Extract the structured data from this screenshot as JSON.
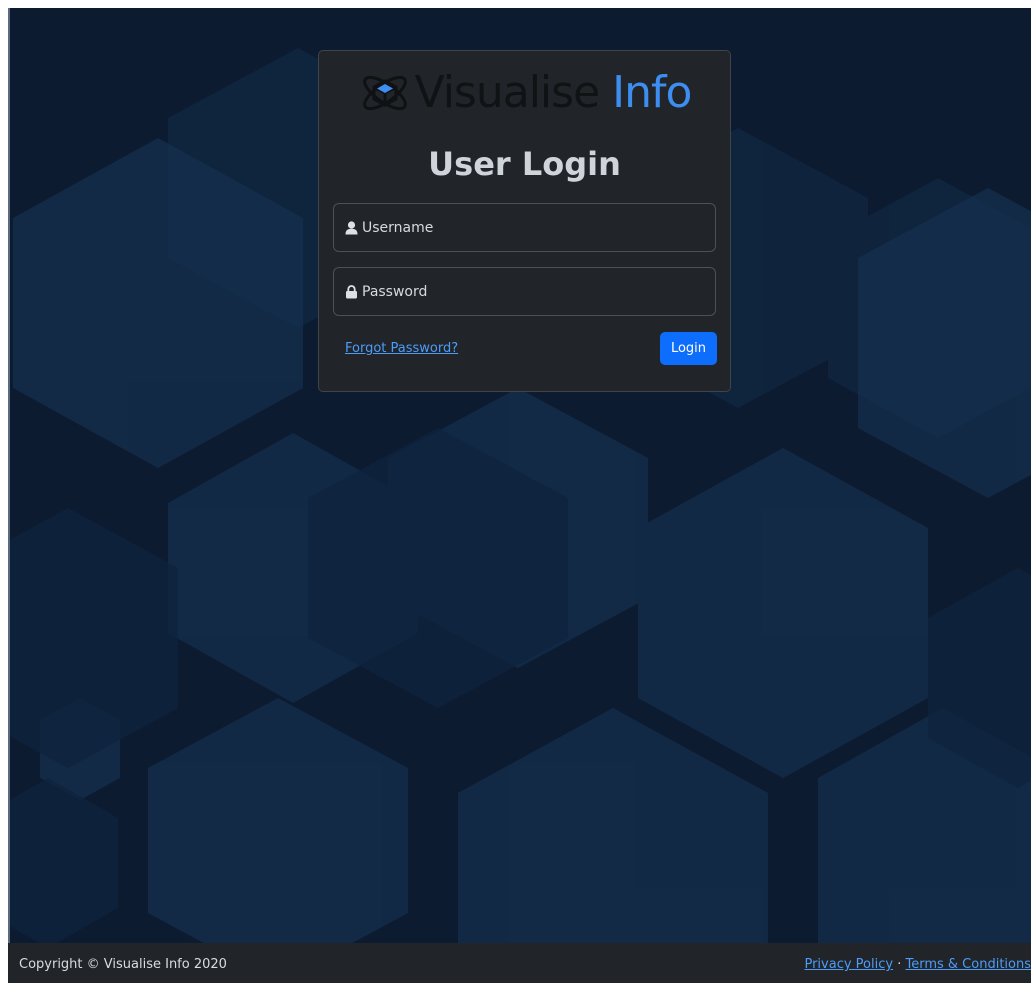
{
  "brand": {
    "logo_word1": "Visualise",
    "logo_word2": "Info",
    "logo_icon": "atom-cube-icon",
    "word2_color": "#3d8ef0"
  },
  "login": {
    "title": "User Login",
    "username_placeholder": "Username",
    "password_placeholder": "Password",
    "user_icon": "user-icon",
    "lock_icon": "lock-icon",
    "forgot_label": "Forgot Password?",
    "submit_label": "Login",
    "submit_color": "#0d6efd"
  },
  "footer": {
    "copyright": "Copyright © Visualise Info 2020",
    "privacy_label": "Privacy Policy",
    "separator": "·",
    "terms_label": "Terms & Conditions"
  },
  "colors": {
    "background": "#0c1b30",
    "card": "#212529",
    "link": "#4d9cf8"
  }
}
